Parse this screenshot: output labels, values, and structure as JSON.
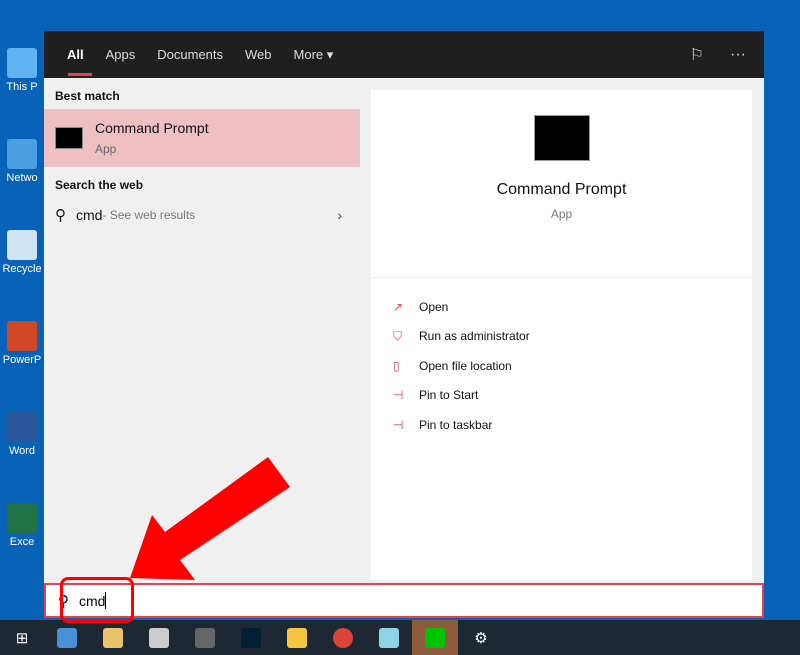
{
  "desktop": [
    {
      "label": "This P",
      "color": "#5fb3f0"
    },
    {
      "label": "Netwo",
      "color": "#4aa0e0"
    },
    {
      "label": "Recycle",
      "color": "#cfe3f2"
    },
    {
      "label": "PowerP",
      "color": "#d24726"
    },
    {
      "label": "Word",
      "color": "#2b579a"
    },
    {
      "label": "Exce",
      "color": "#217346"
    }
  ],
  "header": {
    "tabs": [
      "All",
      "Apps",
      "Documents",
      "Web",
      "More ▾"
    ],
    "active": "All",
    "feedback_icon": "feedback-icon",
    "more_icon": "···"
  },
  "left": {
    "best_match_heading": "Best match",
    "best": {
      "title": "Command Prompt",
      "subtitle": "App"
    },
    "web_heading": "Search the web",
    "web": {
      "query": "cmd",
      "desc": " - See web results"
    }
  },
  "right": {
    "title": "Command Prompt",
    "subtitle": "App",
    "actions": [
      {
        "label": "Open",
        "icon": "open-icon"
      },
      {
        "label": "Run as administrator",
        "icon": "shield-icon"
      },
      {
        "label": "Open file location",
        "icon": "folder-icon"
      },
      {
        "label": "Pin to Start",
        "icon": "pin-icon"
      },
      {
        "label": "Pin to taskbar",
        "icon": "pin-icon"
      }
    ]
  },
  "search": {
    "value": "cmd"
  },
  "colors": {
    "accent": "#e8404f",
    "highlight": "#efc0c3",
    "annotation": "#ff0000"
  },
  "taskbar": [
    "windows-start",
    "remote-desktop",
    "paint",
    "app-a",
    "app-polygon",
    "photoshop",
    "file-explorer",
    "chrome",
    "notepad",
    "line",
    "settings"
  ]
}
